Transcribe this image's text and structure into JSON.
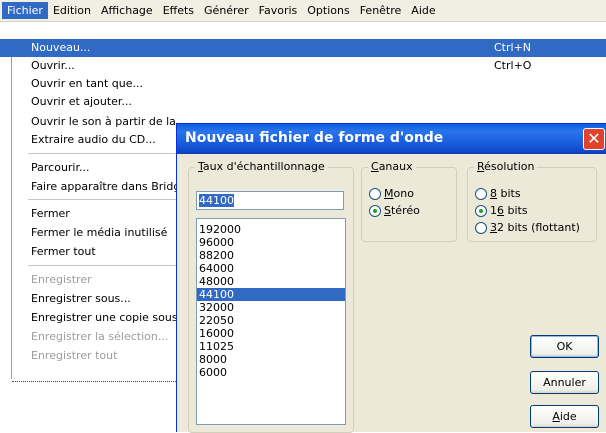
{
  "menubar": {
    "items": [
      "Fichier",
      "Edition",
      "Affichage",
      "Effets",
      "Générer",
      "Favoris",
      "Options",
      "Fenêtre",
      "Aide"
    ]
  },
  "file_menu": {
    "items": [
      {
        "label": "Nouveau...",
        "shortcut": "Ctrl+N"
      },
      {
        "label": "Ouvrir...",
        "shortcut": "Ctrl+O"
      },
      {
        "label": "Ouvrir en tant que...",
        "shortcut": ""
      },
      {
        "label": "Ouvrir et ajouter...",
        "shortcut": ""
      },
      {
        "label": "Ouvrir le son à partir de la",
        "shortcut": ""
      },
      {
        "label": "Extraire audio du CD...",
        "shortcut": ""
      },
      {
        "label": "Parcourir...",
        "shortcut": ""
      },
      {
        "label": "Faire apparaître dans Bridg",
        "shortcut": ""
      },
      {
        "label": "Fermer",
        "shortcut": ""
      },
      {
        "label": "Fermer le média inutilisé",
        "shortcut": ""
      },
      {
        "label": "Fermer tout",
        "shortcut": ""
      },
      {
        "label": "Enregistrer",
        "shortcut": ""
      },
      {
        "label": "Enregistrer sous...",
        "shortcut": ""
      },
      {
        "label": "Enregistrer une copie sous",
        "shortcut": ""
      },
      {
        "label": "Enregistrer la sélection...",
        "shortcut": ""
      },
      {
        "label": "Enregistrer tout",
        "shortcut": ""
      }
    ]
  },
  "dialog": {
    "title": "Nouveau fichier de forme d'onde",
    "close_label": "✕",
    "rate_group": {
      "caption_key": "T",
      "caption_rest": "aux d'échantillonnage",
      "input_value": "44100",
      "options": [
        "192000",
        "96000",
        "88200",
        "64000",
        "48000",
        "44100",
        "32000",
        "22050",
        "16000",
        "11025",
        "8000",
        "6000"
      ],
      "selected": "44100"
    },
    "channels_group": {
      "caption_key": "C",
      "caption_rest": "anaux",
      "mono_key": "M",
      "mono_rest": "ono",
      "stereo_key": "S",
      "stereo_rest": "téréo",
      "selected": "Stéréo"
    },
    "resolution_group": {
      "caption_key": "R",
      "caption_rest": "ésolution",
      "r8_key": "8",
      "r8_rest": " bits",
      "r16_pre": "1",
      "r16_key": "6",
      "r16_rest": " bits",
      "r32_key": "3",
      "r32_rest": "2 bits (flottant)",
      "selected": "16 bits"
    },
    "buttons": {
      "ok": "OK",
      "cancel": "Annuler",
      "help_key": "A",
      "help_rest": "ide"
    }
  },
  "colors": {
    "menu_highlight": "#316ac5",
    "title_bar": "#0a5fde",
    "close_button": "#e0432d",
    "dialog_bg": "#ece9d8"
  }
}
